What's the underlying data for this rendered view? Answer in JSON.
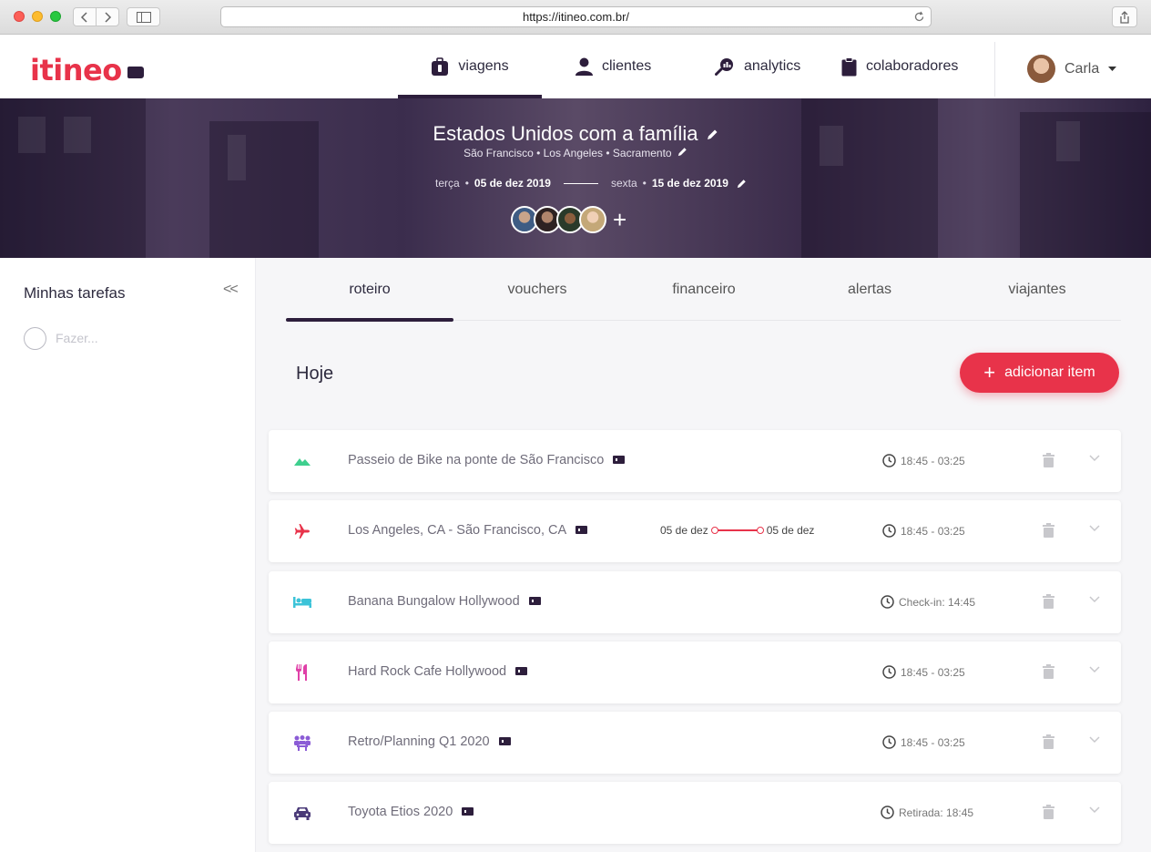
{
  "browser": {
    "url": "https://itineo.com.br/"
  },
  "header": {
    "logo": "itineo",
    "nav": [
      {
        "label": "viagens",
        "icon": "suitcase-icon",
        "active": true
      },
      {
        "label": "clientes",
        "icon": "person-icon",
        "active": false
      },
      {
        "label": "analytics",
        "icon": "analytics-icon",
        "active": false
      },
      {
        "label": "colaboradores",
        "icon": "clipboard-icon",
        "active": false
      }
    ],
    "user": {
      "name": "Carla"
    }
  },
  "trip": {
    "title": "Estados Unidos com a família",
    "cities": "São Francisco • Los Angeles • Sacramento",
    "start_day": "terça",
    "start_date": "05 de dez 2019",
    "end_day": "sexta",
    "end_date": "15 de dez 2019",
    "add_traveler": "+"
  },
  "tasks": {
    "title": "Minhas tarefas",
    "collapse": "<<",
    "placeholder": "Fazer..."
  },
  "tabs": [
    {
      "label": "roteiro",
      "active": true
    },
    {
      "label": "vouchers",
      "active": false
    },
    {
      "label": "financeiro",
      "active": false
    },
    {
      "label": "alertas",
      "active": false
    },
    {
      "label": "viajantes",
      "active": false
    }
  ],
  "day": {
    "title": "Hoje",
    "add_button": "adicionar item"
  },
  "items": [
    {
      "name": "Passeio de Bike na ponte de São Francisco",
      "icon": "mountain-icon",
      "color": "#3ecf8e",
      "time": "18:45 - 03:25"
    },
    {
      "name": "Los Angeles, CA - São Francisco, CA",
      "icon": "airplane-icon",
      "color": "#e8334a",
      "time": "18:45 - 03:25",
      "range_start": "05 de dez",
      "range_end": "05 de dez"
    },
    {
      "name": "Banana Bungalow Hollywood",
      "icon": "bed-icon",
      "color": "#3cc3d8",
      "time": "Check-in: 14:45"
    },
    {
      "name": "Hard Rock Cafe Hollywood",
      "icon": "restaurant-icon",
      "color": "#e040a8",
      "time": "18:45 - 03:25"
    },
    {
      "name": "Retro/Planning Q1 2020",
      "icon": "meeting-icon",
      "color": "#8b5cd6",
      "time": "18:45 - 03:25"
    },
    {
      "name": "Toyota Etios 2020",
      "icon": "car-icon",
      "color": "#4a3a78",
      "time": "Retirada: 18:45"
    }
  ]
}
